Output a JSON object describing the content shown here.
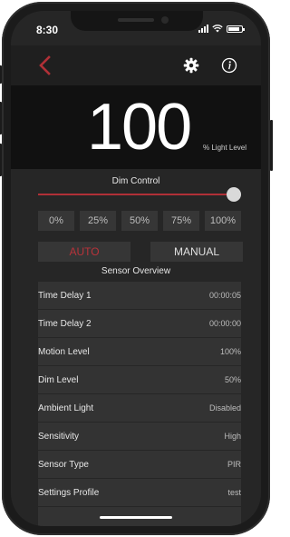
{
  "status_bar": {
    "time": "8:30"
  },
  "nav": {
    "back_icon": "chevron-left-icon",
    "settings_icon": "gear-icon",
    "info_icon": "info-icon",
    "accent_color": "#b03037"
  },
  "light_level": {
    "value": "100",
    "unit": "% Light Level"
  },
  "dim_control": {
    "title": "Dim Control",
    "slider_value_percent": 100,
    "presets": [
      "0%",
      "25%",
      "50%",
      "75%",
      "100%"
    ]
  },
  "mode": {
    "auto_label": "AUTO",
    "manual_label": "MANUAL",
    "selected": "AUTO",
    "selected_color": "#b8333a"
  },
  "sensor_overview": {
    "title": "Sensor Overview",
    "rows": [
      {
        "label": "Time Delay 1",
        "value": "00:00:05"
      },
      {
        "label": "Time Delay 2",
        "value": "00:00:00"
      },
      {
        "label": "Motion Level",
        "value": "100%"
      },
      {
        "label": "Dim Level",
        "value": "50%"
      },
      {
        "label": "Ambient Light",
        "value": "Disabled"
      },
      {
        "label": "Sensitivity",
        "value": "High"
      },
      {
        "label": "Sensor Type",
        "value": "PIR"
      },
      {
        "label": "Settings Profile",
        "value": "test"
      }
    ]
  }
}
